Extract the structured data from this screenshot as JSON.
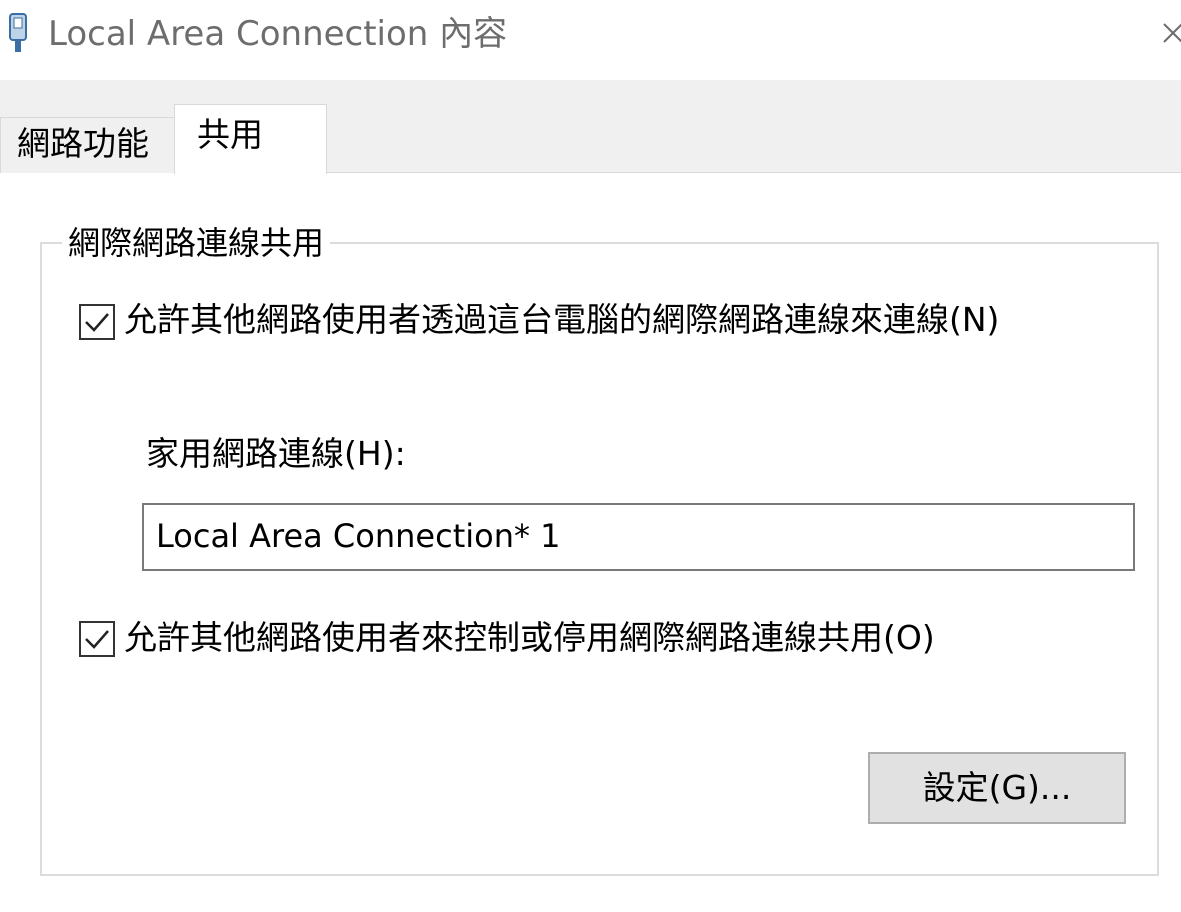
{
  "window": {
    "title": "Local Area Connection 內容",
    "icon": "network-connection-icon",
    "close_icon": "close-icon"
  },
  "tabs": [
    {
      "label": "網路功能",
      "active": false
    },
    {
      "label": "共用",
      "active": true
    }
  ],
  "ics_group": {
    "label": "網際網路連線共用",
    "allow_connect": {
      "label": "允許其他網路使用者透過這台電腦的網際網路連線來連線(N)",
      "checked": true
    },
    "home_connection": {
      "label": "家用網路連線(H):",
      "value": "Local Area Connection* 1"
    },
    "allow_control": {
      "label": "允許其他網路使用者來控制或停用網際網路連線共用(O)",
      "checked": true
    },
    "settings_button": "設定(G)..."
  }
}
